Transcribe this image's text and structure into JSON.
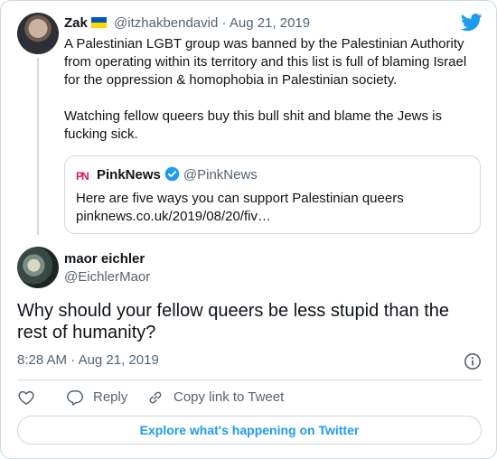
{
  "parent": {
    "author_name": "Zak",
    "flag_colors": [
      "#0057b7",
      "#ffd700"
    ],
    "handle": "@itzhakbendavid",
    "separator": "·",
    "date": "Aug 21, 2019",
    "paragraph1": "A Palestinian LGBT group was banned by the Palestinian Authority from operating within its territory and this list is full of blaming Israel for the oppression & homophobia in Palestinian society.",
    "paragraph2": "Watching fellow queers buy this bull shit and blame the Jews is fucking sick.",
    "quoted": {
      "logo_text": "PN",
      "name": "PinkNews",
      "handle": "@PinkNews",
      "text": "Here are five ways you can support Palestinian queers",
      "link": "pinknews.co.uk/2019/08/20/fiv…"
    }
  },
  "tweet": {
    "author_name": "maor eichler",
    "handle": "@EichlerMaor",
    "text": "Why should your fellow queers be less stupid than the rest of humanity?",
    "time": "8:28 AM",
    "separator": "·",
    "date": "Aug 21, 2019"
  },
  "actions": {
    "reply_label": "Reply",
    "copy_label": "Copy link to Tweet"
  },
  "explore_label": "Explore what's happening on Twitter",
  "colors": {
    "accent": "#1d9bf0",
    "muted": "#536471",
    "border": "#cfd9de",
    "text": "#0f1419"
  },
  "icons": [
    "twitter-logo-icon",
    "verified-badge-icon",
    "info-icon",
    "heart-icon",
    "reply-icon",
    "link-icon"
  ]
}
